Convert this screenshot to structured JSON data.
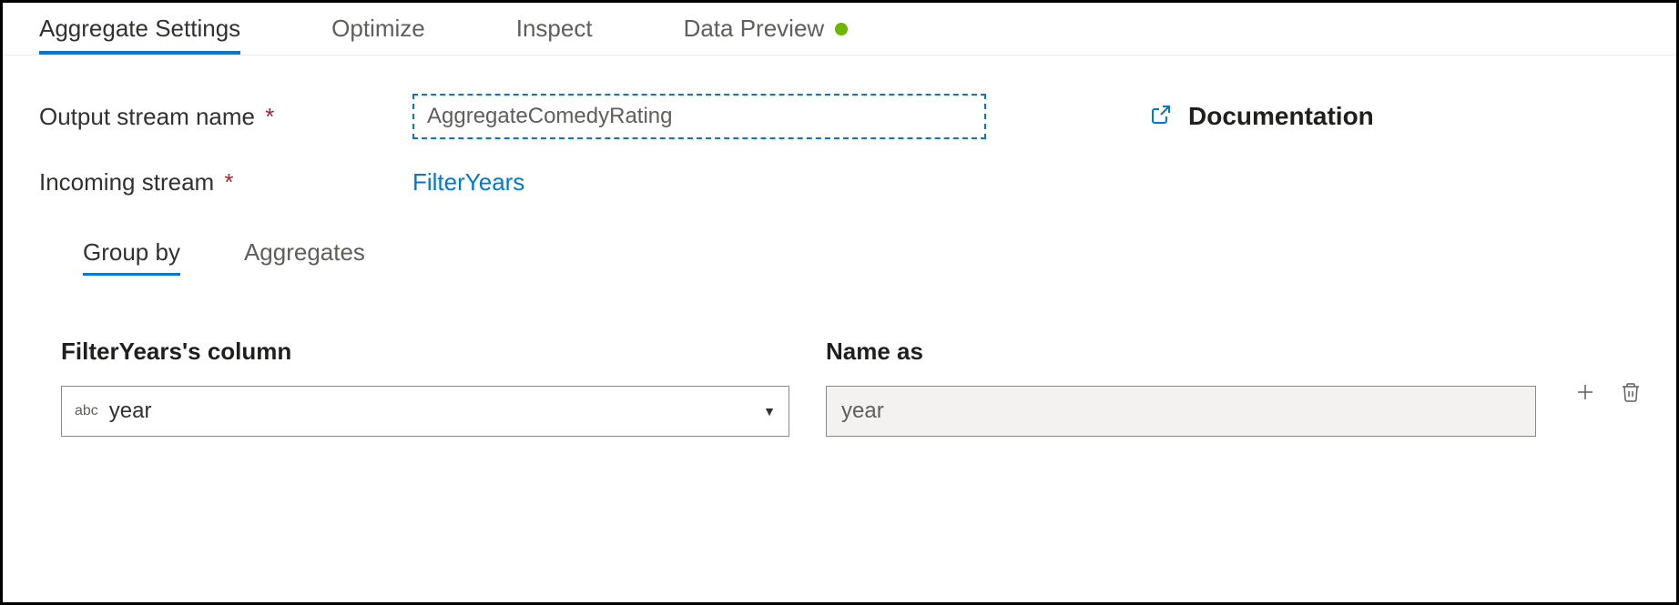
{
  "tabs": {
    "aggregate_settings": "Aggregate Settings",
    "optimize": "Optimize",
    "inspect": "Inspect",
    "data_preview": "Data Preview"
  },
  "fields": {
    "output_stream_label": "Output stream name",
    "output_stream_value": "AggregateComedyRating",
    "incoming_stream_label": "Incoming stream",
    "incoming_stream_value": "FilterYears"
  },
  "documentation": "Documentation",
  "subtabs": {
    "group_by": "Group by",
    "aggregates": "Aggregates"
  },
  "grid": {
    "col1_header": "FilterYears's column",
    "col2_header": "Name as",
    "type_prefix": "abc",
    "column_value": "year",
    "name_value": "year"
  }
}
